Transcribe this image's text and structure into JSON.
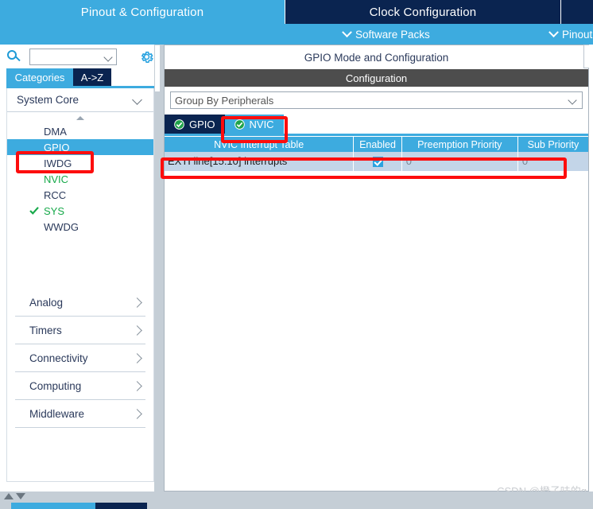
{
  "window": {
    "top_tabs": [
      {
        "label": "Pinout & Configuration",
        "state": "active"
      },
      {
        "label": "Clock Configuration",
        "state": "inactive"
      },
      {
        "label": "",
        "state": "inactive"
      }
    ],
    "menu_links": [
      {
        "label": "Software Packs",
        "icon": "chevron-down-icon"
      },
      {
        "label": "Pinout",
        "icon": "chevron-down-icon"
      }
    ]
  },
  "sidebar": {
    "search": {
      "value": "",
      "placeholder": ""
    },
    "search_icon": "search-icon",
    "settings_icon": "gear-icon",
    "tabs": [
      {
        "label": "Categories",
        "selected": true
      },
      {
        "label": "A->Z",
        "selected": false
      }
    ],
    "group": {
      "label": "System Core",
      "icon": "chevron-down-icon"
    },
    "items": [
      {
        "label": "DMA",
        "state": "normal",
        "checked": false
      },
      {
        "label": "GPIO",
        "state": "selected",
        "checked": false
      },
      {
        "label": "IWDG",
        "state": "normal",
        "checked": false
      },
      {
        "label": "NVIC",
        "state": "configured",
        "checked": false
      },
      {
        "label": "RCC",
        "state": "normal",
        "checked": false
      },
      {
        "label": "SYS",
        "state": "configured",
        "checked": true
      },
      {
        "label": "WWDG",
        "state": "normal",
        "checked": false
      }
    ],
    "categories": [
      {
        "label": "Analog",
        "icon": "chevron-right-icon"
      },
      {
        "label": "Timers",
        "icon": "chevron-right-icon"
      },
      {
        "label": "Connectivity",
        "icon": "chevron-right-icon"
      },
      {
        "label": "Computing",
        "icon": "chevron-right-icon"
      },
      {
        "label": "Middleware",
        "icon": "chevron-right-icon"
      }
    ]
  },
  "main": {
    "mode_title": "GPIO Mode and Configuration",
    "configuration_band": "Configuration",
    "group_by": {
      "value": "Group By Peripherals",
      "icon": "chevron-down-icon"
    },
    "peripheral_tabs": [
      {
        "label": "GPIO",
        "selected": false,
        "status_icon": "check-circle-icon"
      },
      {
        "label": "NVIC",
        "selected": true,
        "status_icon": "check-circle-icon"
      }
    ],
    "table": {
      "headers": [
        "NVIC Interrupt Table",
        "Enabled",
        "Preemption Priority",
        "Sub Priority"
      ],
      "rows": [
        {
          "name": "EXTI line[15:10] interrupts",
          "enabled": true,
          "preemption_priority": "0",
          "sub_priority": "0"
        }
      ]
    }
  },
  "annotations": [
    {
      "target": "sidebar-item-gpio",
      "color": "#fd0d0d"
    },
    {
      "target": "peripheral-tab-nvic",
      "color": "#fd0d0d"
    },
    {
      "target": "nvic-table-row",
      "color": "#fd0d0d"
    }
  ],
  "watermark": {
    "text": "CSDN @橙子味的q"
  },
  "colors": {
    "accent_blue": "#3dabdf",
    "dark_navy": "#0a2450",
    "highlight_red": "#fd0d0d",
    "row_blue": "#c3d5e8",
    "configured_green": "#17a94a",
    "band_gray": "#4d4d4d"
  }
}
